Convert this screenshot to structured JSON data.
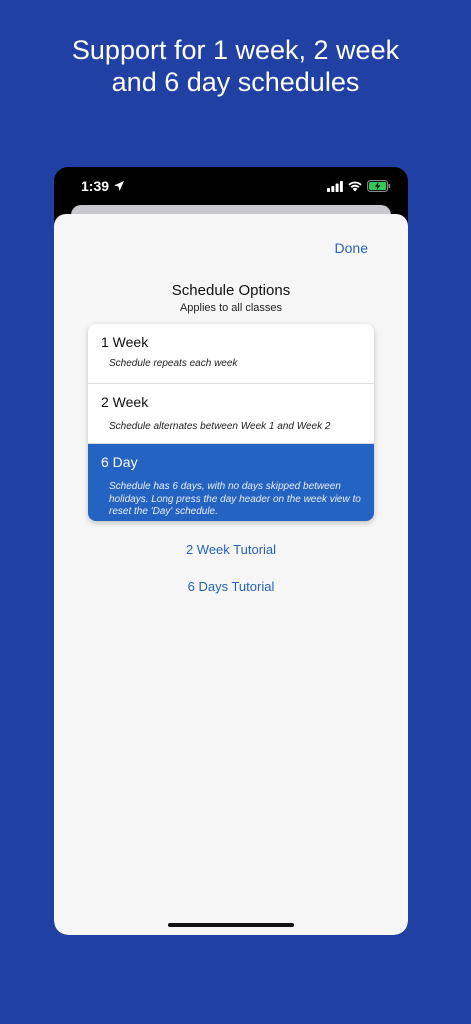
{
  "headline": {
    "line1": "Support for 1 week, 2 week",
    "line2": "and 6 day schedules"
  },
  "status_bar": {
    "time": "1:39",
    "icons": [
      "location-arrow-icon",
      "cellular-signal-icon",
      "wifi-icon",
      "battery-charging-icon"
    ],
    "battery_color": "#34c759"
  },
  "sheet": {
    "done_label": "Done",
    "title": "Schedule Options",
    "subtitle": "Applies to all classes",
    "options": [
      {
        "label": "1 Week",
        "description": "Schedule repeats each week",
        "selected": false
      },
      {
        "label": "2 Week",
        "description": "Schedule alternates between Week 1 and Week 2",
        "selected": false
      },
      {
        "label": "6 Day",
        "description": "Schedule has 6 days, with no days skipped between holidays.  Long press the day header on the week view to reset the 'Day' schedule.",
        "selected": true
      }
    ],
    "links": [
      "2 Week Tutorial",
      "6 Days Tutorial"
    ]
  },
  "colors": {
    "background": "#2140a3",
    "accent": "#2563b8",
    "selected_row": "#2563c2"
  }
}
